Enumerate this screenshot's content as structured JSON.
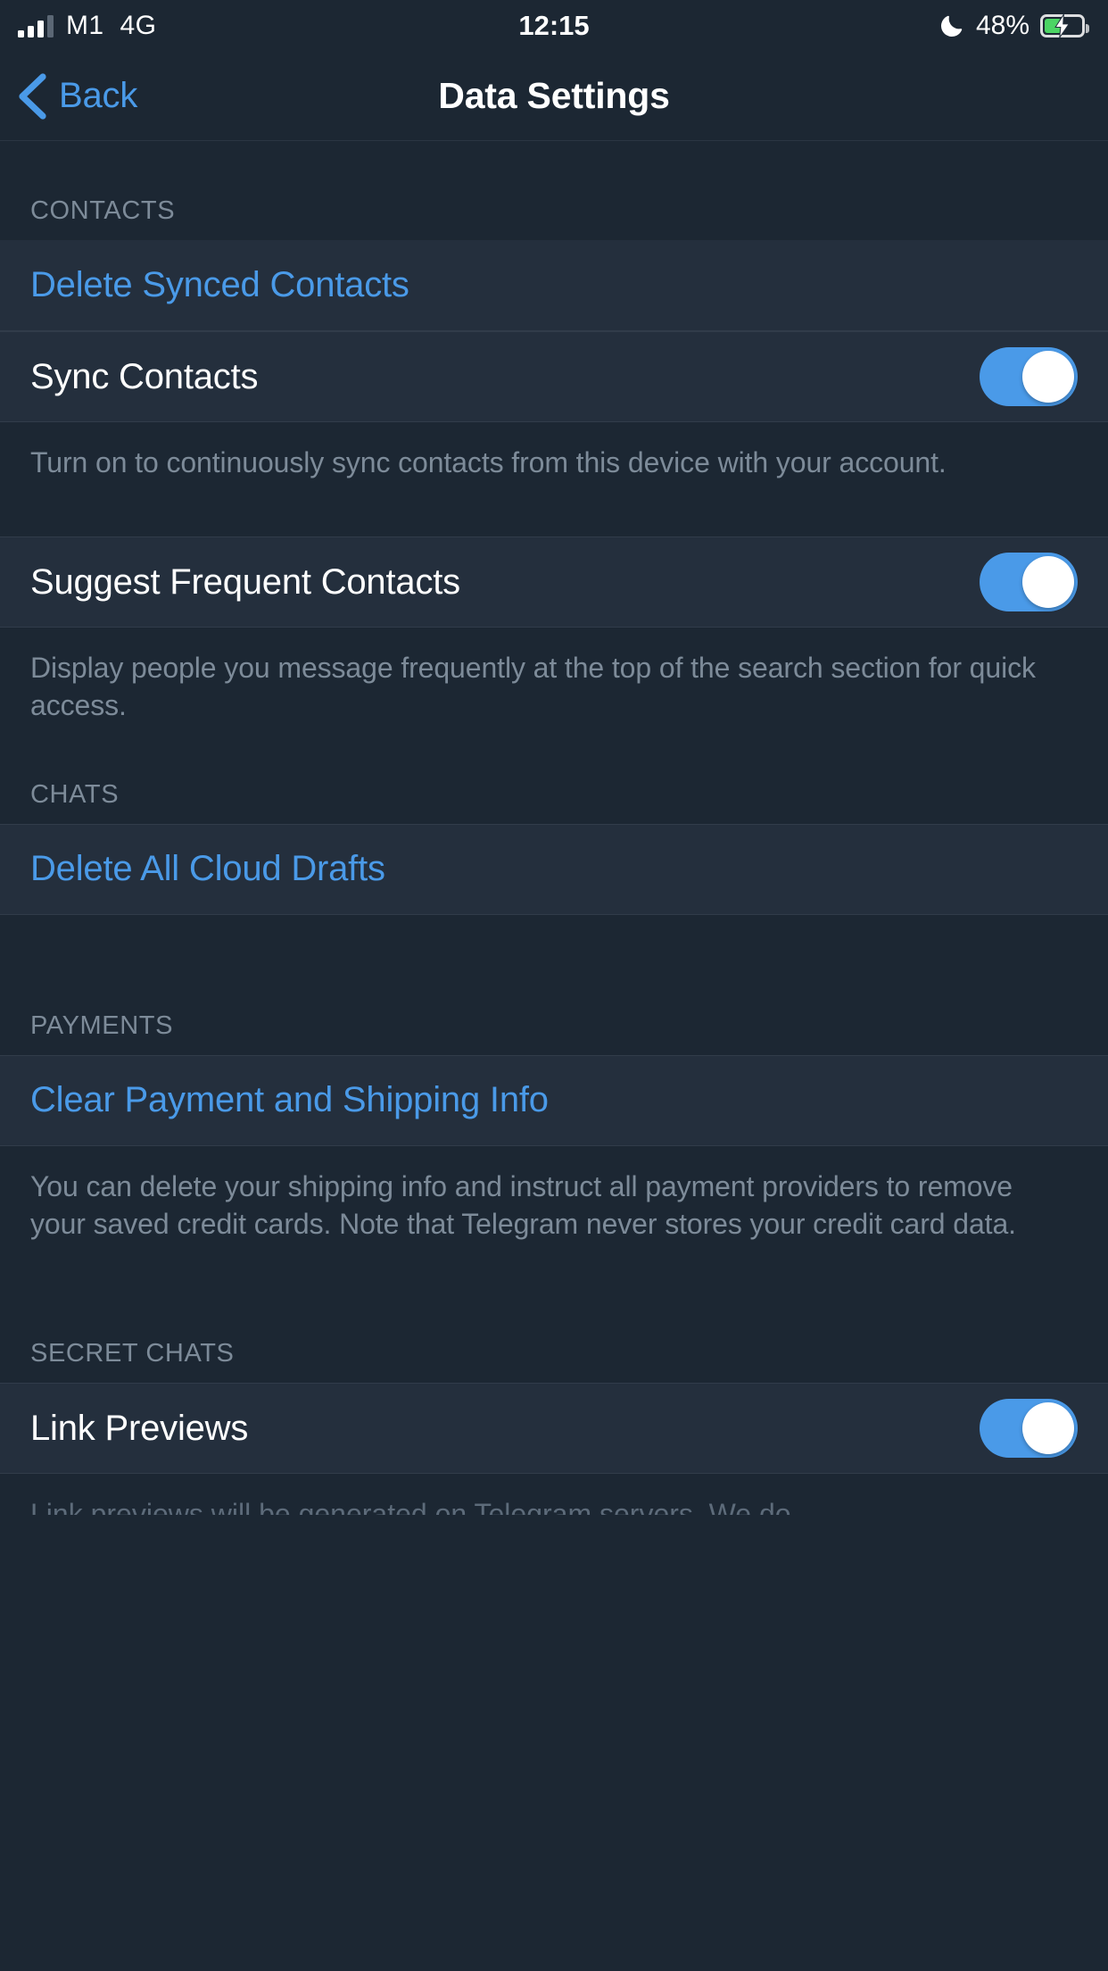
{
  "status_bar": {
    "carrier": "M1",
    "network": "4G",
    "time": "12:15",
    "battery_percent": "48%",
    "signal_bars_filled": 3,
    "signal_bars_total": 4,
    "dnd_icon": "moon-icon",
    "battery_icon": "battery-charging-icon",
    "battery_fill_color": "#4cd464"
  },
  "nav": {
    "back_label": "Back",
    "back_icon": "chevron-left-icon",
    "title": "Data Settings",
    "accent_color": "#4a9ae8"
  },
  "sections": [
    {
      "header": "CONTACTS",
      "rows": [
        {
          "label": "Delete Synced Contacts",
          "type": "action"
        },
        {
          "label": "Sync Contacts",
          "type": "toggle",
          "value": "on"
        }
      ],
      "footer": "Turn on to continuously sync contacts from this device with your account."
    },
    {
      "header": "",
      "rows": [
        {
          "label": "Suggest Frequent Contacts",
          "type": "toggle",
          "value": "on"
        }
      ],
      "footer": "Display people you message frequently at the top of the search section for quick access."
    },
    {
      "header": "CHATS",
      "rows": [
        {
          "label": "Delete All Cloud Drafts",
          "type": "action"
        }
      ],
      "footer": ""
    },
    {
      "header": "PAYMENTS",
      "rows": [
        {
          "label": "Clear Payment and Shipping Info",
          "type": "action"
        }
      ],
      "footer": "You can delete your shipping info and instruct all payment providers to remove your saved credit cards. Note that Telegram never stores your credit card data."
    },
    {
      "header": "SECRET CHATS",
      "rows": [
        {
          "label": "Link Previews",
          "type": "toggle",
          "value": "on"
        }
      ],
      "footer": "Link previews will be generated on Telegram servers. We do"
    }
  ],
  "theme": {
    "page_background": "#1c2733",
    "row_background": "#242f3d",
    "accent": "#4a9ae8",
    "muted_text": "#7d8b99",
    "toggle_on": "#4a9ae8"
  }
}
